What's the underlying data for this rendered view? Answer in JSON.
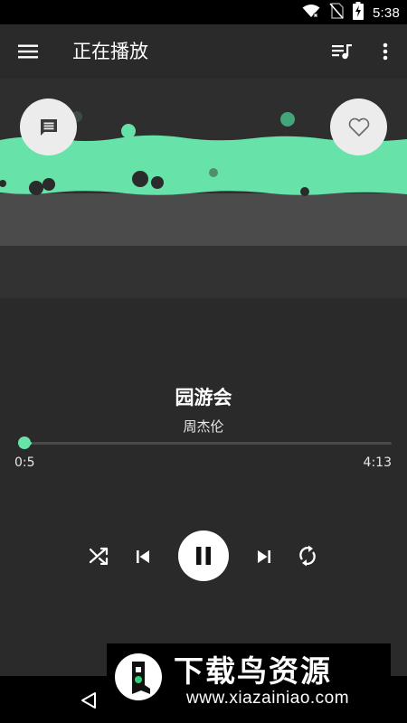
{
  "status_bar": {
    "time": "5:38"
  },
  "toolbar": {
    "title": "正在播放"
  },
  "song": {
    "title": "园游会",
    "artist": "周杰伦"
  },
  "progress": {
    "current": "0:5",
    "total": "4:13",
    "fraction": 0.02
  },
  "player": {
    "state": "playing"
  },
  "colors": {
    "accent": "#67e3a9",
    "background": "#2a2a2a",
    "status_bar": "#000000"
  },
  "icons": {
    "status": [
      "wifi-icon",
      "no-sim-icon",
      "battery-charging-icon"
    ],
    "toolbar": [
      "menu-icon",
      "queue-music-icon",
      "more-vert-icon"
    ],
    "visual": [
      "comment-icon",
      "heart-outline-icon"
    ],
    "controls": [
      "shuffle-icon",
      "skip-previous-icon",
      "pause-icon",
      "skip-next-icon",
      "repeat-icon"
    ],
    "nav": [
      "back-icon"
    ]
  },
  "watermark": {
    "title": "下载鸟资源",
    "url": "www.xiazainiao.com"
  }
}
